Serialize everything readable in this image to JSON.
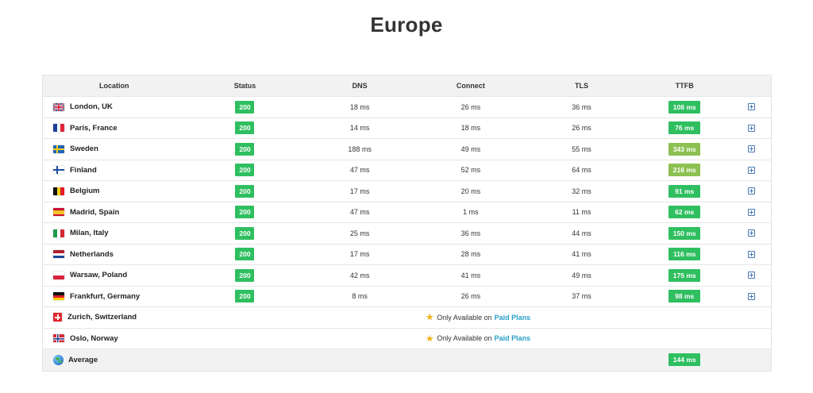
{
  "title": "Europe",
  "columns": [
    "Location",
    "Status",
    "DNS",
    "Connect",
    "TLS",
    "TTFB"
  ],
  "rows": [
    {
      "location": "London, UK",
      "flag": "uk-flag",
      "status": "200",
      "dns": "18 ms",
      "connect": "26 ms",
      "tls": "36 ms",
      "ttfb": "108 ms",
      "ttfb_color": "#2fbf60"
    },
    {
      "location": "Paris, France",
      "flag": "france-flag",
      "status": "200",
      "dns": "14 ms",
      "connect": "18 ms",
      "tls": "26 ms",
      "ttfb": "76 ms",
      "ttfb_color": "#2fbf60"
    },
    {
      "location": "Sweden",
      "flag": "sweden-flag",
      "status": "200",
      "dns": "188 ms",
      "connect": "49 ms",
      "tls": "55 ms",
      "ttfb": "343 ms",
      "ttfb_color": "#8cc152"
    },
    {
      "location": "Finland",
      "flag": "finland-flag",
      "status": "200",
      "dns": "47 ms",
      "connect": "52 ms",
      "tls": "64 ms",
      "ttfb": "216 ms",
      "ttfb_color": "#8cc152"
    },
    {
      "location": "Belgium",
      "flag": "belgium-flag",
      "status": "200",
      "dns": "17 ms",
      "connect": "20 ms",
      "tls": "32 ms",
      "ttfb": "91 ms",
      "ttfb_color": "#2fbf60"
    },
    {
      "location": "Madrid, Spain",
      "flag": "spain-flag",
      "status": "200",
      "dns": "47 ms",
      "connect": "1 ms",
      "tls": "11 ms",
      "ttfb": "62 ms",
      "ttfb_color": "#2fbf60"
    },
    {
      "location": "Milan, Italy",
      "flag": "italy-flag",
      "status": "200",
      "dns": "25 ms",
      "connect": "36 ms",
      "tls": "44 ms",
      "ttfb": "150 ms",
      "ttfb_color": "#2fbf60"
    },
    {
      "location": "Netherlands",
      "flag": "netherlands-flag",
      "status": "200",
      "dns": "17 ms",
      "connect": "28 ms",
      "tls": "41 ms",
      "ttfb": "116 ms",
      "ttfb_color": "#2fbf60"
    },
    {
      "location": "Warsaw, Poland",
      "flag": "poland-flag",
      "status": "200",
      "dns": "42 ms",
      "connect": "41 ms",
      "tls": "49 ms",
      "ttfb": "175 ms",
      "ttfb_color": "#2fbf60"
    },
    {
      "location": "Frankfurt, Germany",
      "flag": "germany-flag",
      "status": "200",
      "dns": "8 ms",
      "connect": "26 ms",
      "tls": "37 ms",
      "ttfb": "98 ms",
      "ttfb_color": "#2fbf60"
    }
  ],
  "locked_rows": [
    {
      "location": "Zurich, Switzerland",
      "flag": "switzerland-flag",
      "note": "Only Available on",
      "link": "Paid Plans"
    },
    {
      "location": "Oslo, Norway",
      "flag": "norway-flag",
      "note": "Only Available on",
      "link": "Paid Plans"
    }
  ],
  "average": {
    "label": "Average",
    "icon": "globe-icon",
    "ttfb": "144 ms",
    "ttfb_color": "#2fbf60"
  },
  "colors": {
    "status_ok": "#2fbf60",
    "ttfb_fast": "#2fbf60",
    "ttfb_medium": "#8cc152",
    "link": "#2a9fc9",
    "expand_icon": "#4a78b5"
  }
}
